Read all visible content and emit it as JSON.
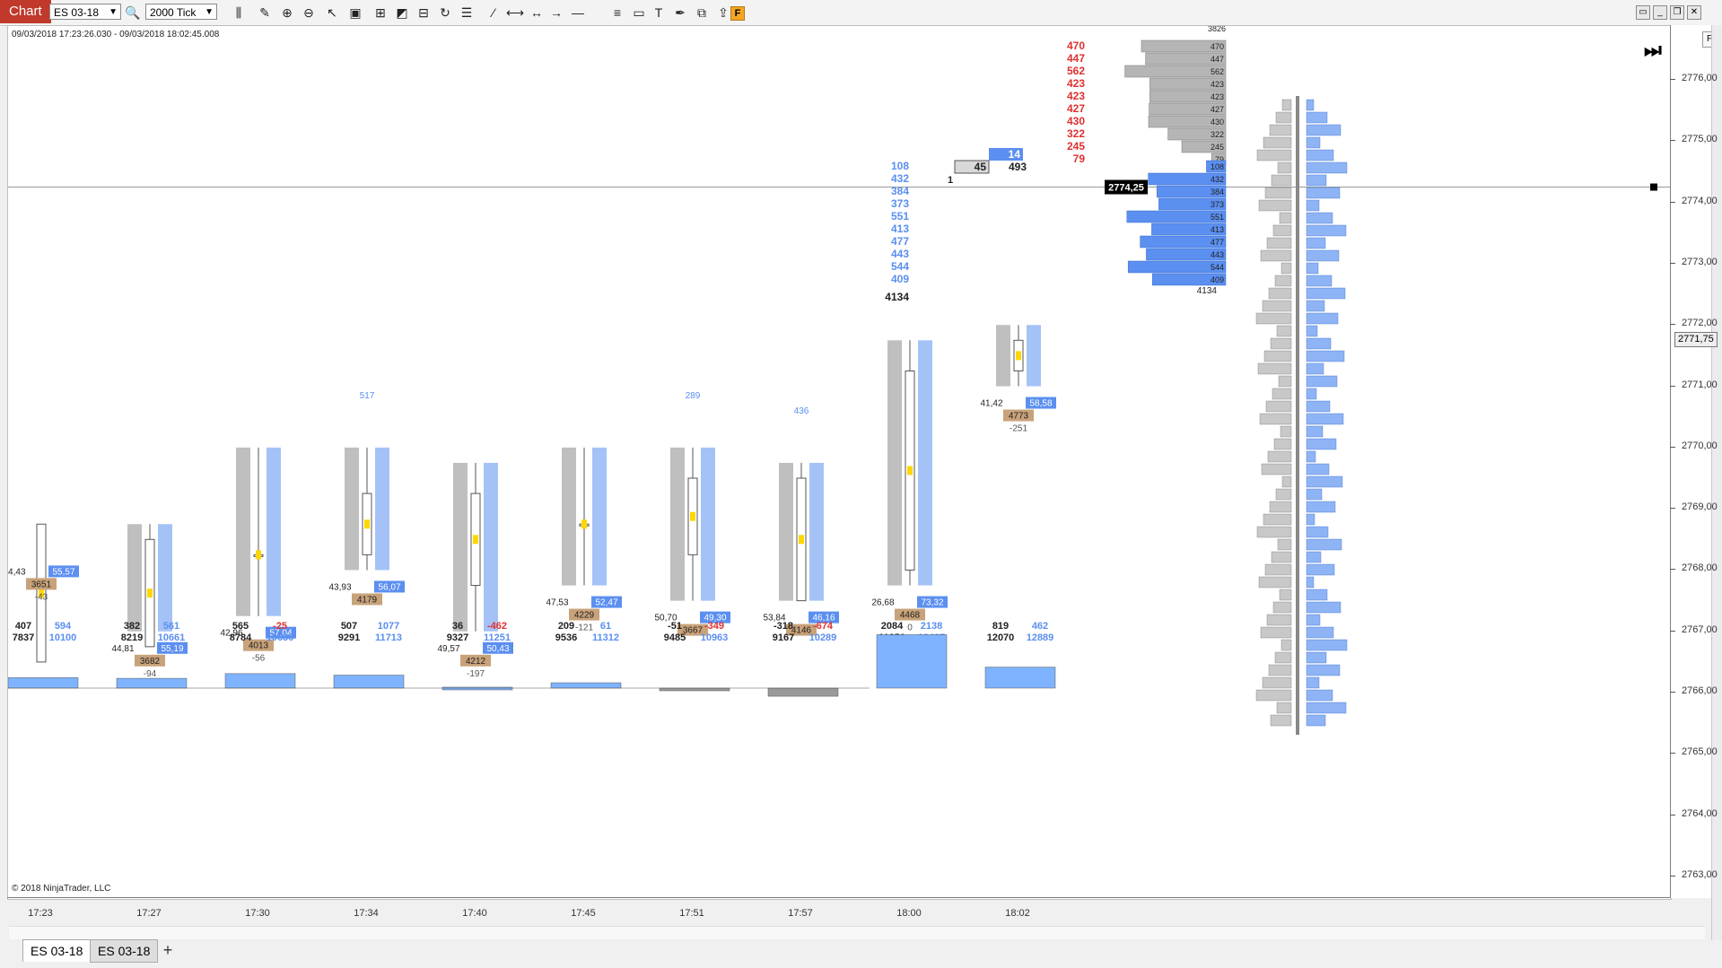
{
  "toolbar": {
    "chart_button": "Chart",
    "instrument": "ES 03-18",
    "interval": "2000 Tick",
    "f_badge": "F"
  },
  "chart": {
    "date_range": "09/03/2018 17:23:26.030 - 09/03/2018 18:02:45.008",
    "copyright": "© 2018 NinjaTrader, LLC",
    "last_price_label": "2771,75",
    "cursor_price_label": "2774,25",
    "bars": [
      {
        "time": "17:23",
        "delta": "407",
        "vol_left": "7837",
        "vol_right": "594",
        "cum": "10100",
        "ohlc": [
          2768.75,
          2767.25,
          2768.25,
          2766.5
        ],
        "top": "",
        "bottom_left": "44,43",
        "bottom_right": "55,57",
        "total": "3651",
        "net": "-43"
      },
      {
        "time": "17:27",
        "delta": "382",
        "vol_left": "8219",
        "vol_right": "561",
        "cum": "10661",
        "ohlc": [
          2768.5,
          2768.75,
          2767.0,
          2766.75
        ],
        "top": "",
        "bottom_left": "44,81",
        "bottom_right": "55,19",
        "total": "3682",
        "net": "-94"
      },
      {
        "time": "17:30",
        "delta": "565",
        "vol_left": "8784",
        "vol_right": "-25",
        "cum": "10636",
        "ohlc": [
          2768.25,
          2770.0,
          2767.25,
          2768.25
        ],
        "top": "",
        "bottom_left": "42,96",
        "bottom_right": "57,04",
        "total": "4013",
        "net": "-56"
      },
      {
        "time": "17:34",
        "delta": "507",
        "vol_left": "9291",
        "vol_right": "1077",
        "cum": "11713",
        "ohlc": [
          2768.25,
          2770.0,
          2768.0,
          2769.25
        ],
        "top": "517",
        "bottom_left": "43,93",
        "bottom_right": "56,07",
        "total": "4179",
        "net": ""
      },
      {
        "time": "17:40",
        "delta": "36",
        "vol_left": "9327",
        "vol_right": "-462",
        "cum": "11251",
        "ohlc": [
          2769.25,
          2769.75,
          2767.0,
          2767.75
        ],
        "top": "",
        "bottom_left": "49,57",
        "bottom_right": "50,43",
        "total": "4212",
        "net": "-197"
      },
      {
        "time": "17:45",
        "delta": "209",
        "vol_left": "9536",
        "vol_right": "61",
        "cum": "11312",
        "ohlc": [
          2768.75,
          2770.0,
          2767.75,
          2768.75
        ],
        "top": "",
        "bottom_left": "47,53",
        "bottom_right": "52,47",
        "total": "4229",
        "net": "-121"
      },
      {
        "time": "17:51",
        "delta": "-51",
        "vol_left": "9485",
        "vol_right": "-349",
        "cum": "10963",
        "ohlc": [
          2768.25,
          2770.0,
          2767.5,
          2769.5
        ],
        "top": "289",
        "bottom_left": "50,70",
        "bottom_right": "49,30",
        "total": "3667",
        "net": ""
      },
      {
        "time": "17:57",
        "delta": "-318",
        "vol_left": "9167",
        "vol_right": "-674",
        "cum": "10289",
        "ohlc": [
          2769.5,
          2769.75,
          2767.5,
          2767.5
        ],
        "top": "436",
        "bottom_left": "53,84",
        "bottom_right": "46,16",
        "total": "4146",
        "net": ""
      },
      {
        "time": "18:00",
        "delta": "2084",
        "vol_left": "11251",
        "vol_right": "2138",
        "cum": "12427",
        "ohlc": [
          2768.0,
          2771.75,
          2767.75,
          2771.25
        ],
        "top": "",
        "bottom_left": "26,68",
        "bottom_right": "73,32",
        "total": "4468",
        "net": "0"
      },
      {
        "time": "18:02",
        "delta": "819",
        "vol_left": "12070",
        "vol_right": "462",
        "cum": "12889",
        "ohlc": [
          2771.25,
          2772.0,
          2771.0,
          2771.75
        ],
        "top": "",
        "bottom_left": "41,42",
        "bottom_right": "58,58",
        "total": "4773",
        "net": "-251"
      }
    ],
    "price_labels": [
      "2776,00",
      "2775,00",
      "2774,00",
      "2773,00",
      "2772,00",
      "2771,00",
      "2770,00",
      "2769,00",
      "2768,00",
      "2767,00",
      "2766,00",
      "2765,00",
      "2764,00",
      "2763,00"
    ],
    "ladder": {
      "bid_sizes": [
        "470",
        "447",
        "562",
        "423",
        "423",
        "427",
        "430",
        "322",
        "245",
        "79"
      ],
      "ask_sizes": [
        "108",
        "432",
        "384",
        "373",
        "551",
        "413",
        "477",
        "443",
        "544",
        "409"
      ],
      "ask_summary": "14",
      "bid_summary": "45",
      "summary_total": "493",
      "one_label": "1",
      "ask_total": "4134",
      "bid_total": "3826"
    },
    "colors": {
      "bullish": "#5b8ff0",
      "bearish": "#8a8a8a",
      "green": "#2e8b2e",
      "red": "#e03030",
      "tan": "#c8a27a",
      "yellow": "#ffd700"
    }
  },
  "tabs": [
    {
      "label": "ES 03-18"
    },
    {
      "label": "ES 03-18"
    }
  ],
  "tab_add": "+"
}
